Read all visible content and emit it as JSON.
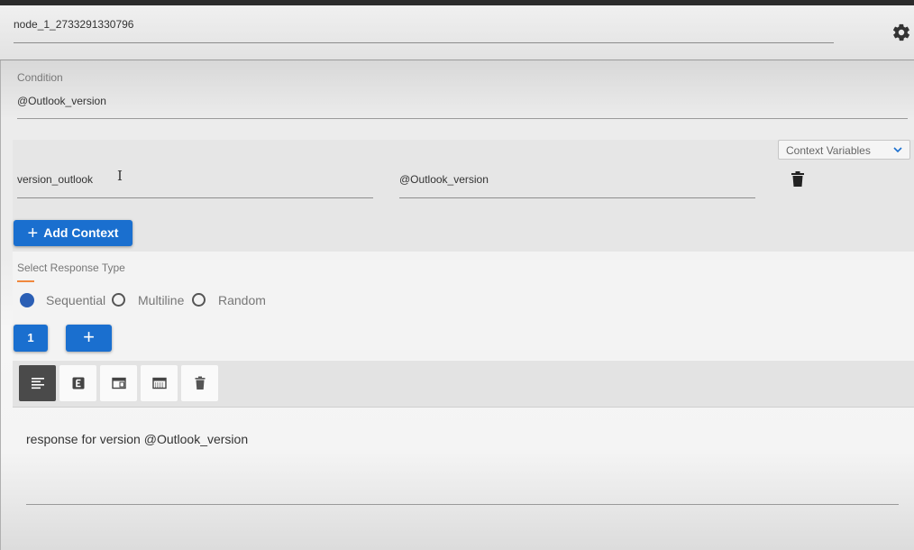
{
  "header": {
    "node_name": "node_1_2733291330796",
    "settings_icon": "gear-icon"
  },
  "condition": {
    "label": "Condition",
    "value": "@Outlook_version"
  },
  "context": {
    "dropdown_label": "Context Variables",
    "variable_name": "version_outlook",
    "variable_value": "@Outlook_version",
    "add_button_label": "Add Context",
    "delete_icon": "trash-icon"
  },
  "response_type": {
    "label": "Select Response Type",
    "options": [
      "Sequential",
      "Multiline",
      "Random"
    ],
    "selected": "Sequential"
  },
  "responses": {
    "index_label": "1",
    "add_label": "+"
  },
  "toolbar": {
    "tools": [
      "text-align-icon",
      "e-box-icon",
      "browser-window-icon",
      "keyboard-icon",
      "trash-icon"
    ],
    "active_tool": "text-align-icon"
  },
  "response_text": "response for version @Outlook_version",
  "colors": {
    "accent": "#1a6fcf",
    "radio_selected": "#2b5fb5",
    "underline_accent": "#f0883e"
  }
}
